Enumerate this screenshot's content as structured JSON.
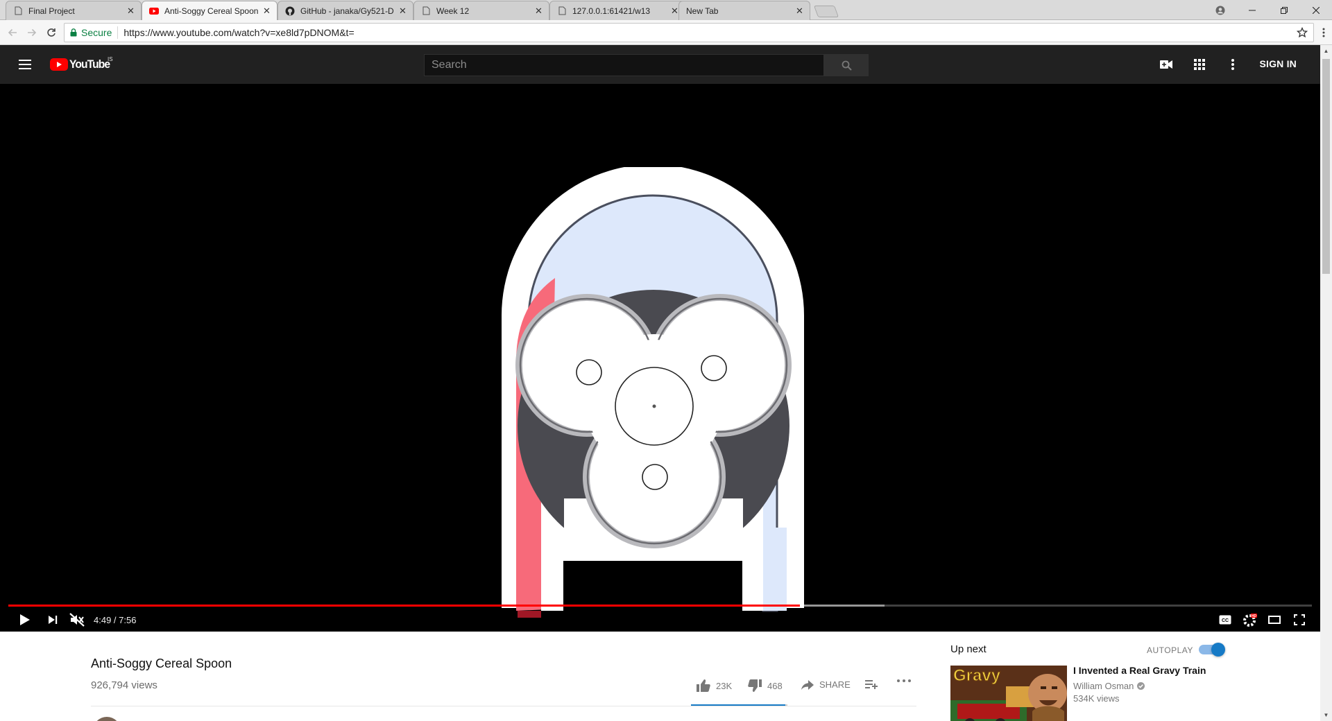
{
  "browser": {
    "tabs": [
      {
        "title": "Final Project",
        "icon": "page-icon"
      },
      {
        "title": "Anti-Soggy Cereal Spoon",
        "icon": "youtube-favicon"
      },
      {
        "title": "GitHub - janaka/Gy521-D",
        "icon": "github-icon"
      },
      {
        "title": "Week 12",
        "icon": "page-icon"
      },
      {
        "title": "127.0.0.1:61421/w13",
        "icon": "page-icon"
      },
      {
        "title": "New Tab",
        "icon": "none"
      }
    ],
    "close_glyph": "✕",
    "secure_label": "Secure",
    "url": "https://www.youtube.com/watch?v=xe8ld7pDNOM&t="
  },
  "youtube": {
    "logo_text": "YouTube",
    "logo_country": "IS",
    "search_placeholder": "Search",
    "sign_in": "SIGN IN"
  },
  "player": {
    "time": "4:49 / 7:56",
    "played_fraction": 0.607,
    "buffered_fraction": 0.672,
    "accent": "#ff0000"
  },
  "video": {
    "title": "Anti-Soggy Cereal Spoon",
    "views": "926,794 views",
    "likes": "23K",
    "dislikes": "468",
    "share_label": "SHARE",
    "like_fraction": 0.98
  },
  "sidebar": {
    "up_next": "Up next",
    "autoplay": "AUTOPLAY",
    "autoplay_on": true,
    "recommendation": {
      "title": "I Invented a Real Gravy Train",
      "channel": "William Osman",
      "views": "534K views",
      "thumb_text": "Gravy"
    }
  }
}
